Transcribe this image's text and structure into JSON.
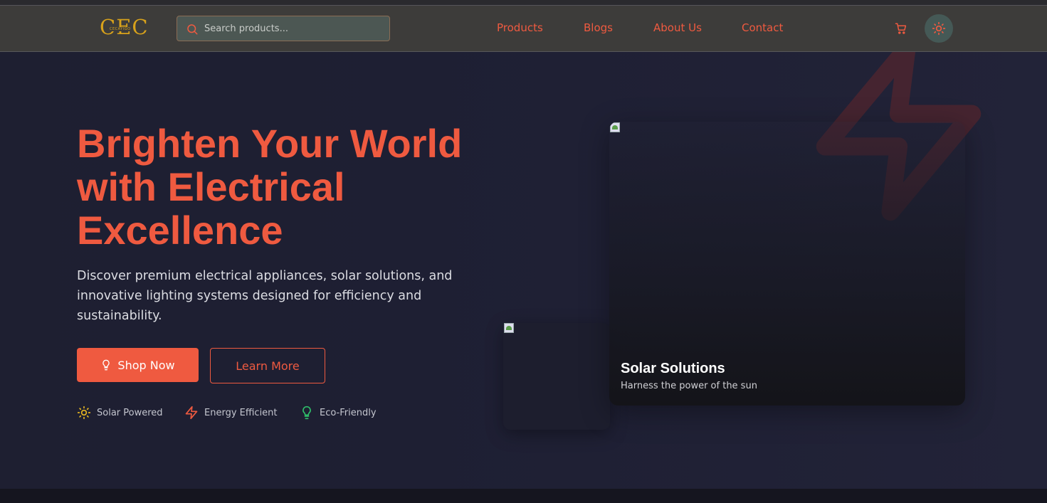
{
  "brand": {
    "logo_text": "CEC",
    "logo_subtext": "CECAYIGO",
    "logo_color": "#d8a21b"
  },
  "search": {
    "placeholder": "Search products...",
    "value": ""
  },
  "nav": {
    "links": [
      "Products",
      "Blogs",
      "About Us",
      "Contact"
    ]
  },
  "header_icons": [
    "search-icon",
    "cart-icon",
    "sun-icon"
  ],
  "hero": {
    "title_line1": "Brighten Your World",
    "title_line2": "with Electrical",
    "title_line3": "Excellence",
    "description": "Discover premium electrical appliances, solar solutions, and innovative lighting systems designed for efficiency and sustainability.",
    "shop_now_label": "Shop Now",
    "learn_more_label": "Learn More",
    "features": [
      {
        "label": "Solar Powered",
        "icon": "sun-icon"
      },
      {
        "label": "Energy Efficient",
        "icon": "lightning-icon"
      },
      {
        "label": "Eco-Friendly",
        "icon": "lightbulb-icon"
      }
    ]
  },
  "featured_card": {
    "title": "Solar Solutions",
    "subtitle": "Harness the power of the sun"
  },
  "colors": {
    "accent": "#ef5a40",
    "background": "#1f2033",
    "navbar": "#3d3c3a",
    "eco_green": "#2fbf6a",
    "solar_yellow": "#e6b520"
  }
}
